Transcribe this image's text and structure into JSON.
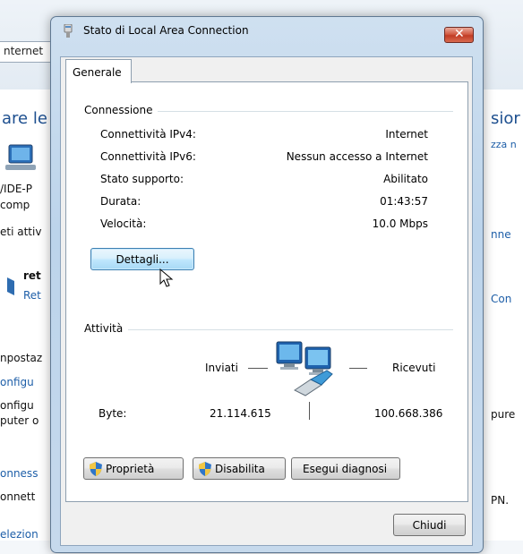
{
  "background": {
    "address_text": "nternet",
    "fragments": [
      "are le",
      "/IDE-P",
      "comp",
      "eti attiv",
      "ret",
      "Ret",
      "npostaz",
      "onfigu",
      "onfigu",
      "puter o",
      "onness",
      "onnett",
      "elezion",
      "sior",
      "zza n",
      "nne",
      "Con",
      "pure",
      "PN."
    ]
  },
  "dialog": {
    "title": "Stato di Local Area Connection",
    "close_label": "✕",
    "tab_label": "Generale",
    "connection": {
      "group_label": "Connessione",
      "rows": [
        {
          "label": "Connettività IPv4:",
          "value": "Internet"
        },
        {
          "label": "Connettività IPv6:",
          "value": "Nessun accesso a Internet"
        },
        {
          "label": "Stato supporto:",
          "value": "Abilitato"
        },
        {
          "label": "Durata:",
          "value": "01:43:57"
        },
        {
          "label": "Velocità:",
          "value": "10.0 Mbps"
        }
      ],
      "details_button": "Dettagli..."
    },
    "activity": {
      "group_label": "Attività",
      "sent_label": "Inviati",
      "received_label": "Ricevuti",
      "bytes_label": "Byte:",
      "bytes_sent": "21.114.615",
      "bytes_received": "100.668.386"
    },
    "buttons": {
      "properties": "Proprietà",
      "disable": "Disabilita",
      "diagnose": "Esegui diagnosi",
      "close": "Chiudi"
    }
  },
  "colors": {
    "accent": "#3c7fb1",
    "title_close": "#c13c25"
  }
}
